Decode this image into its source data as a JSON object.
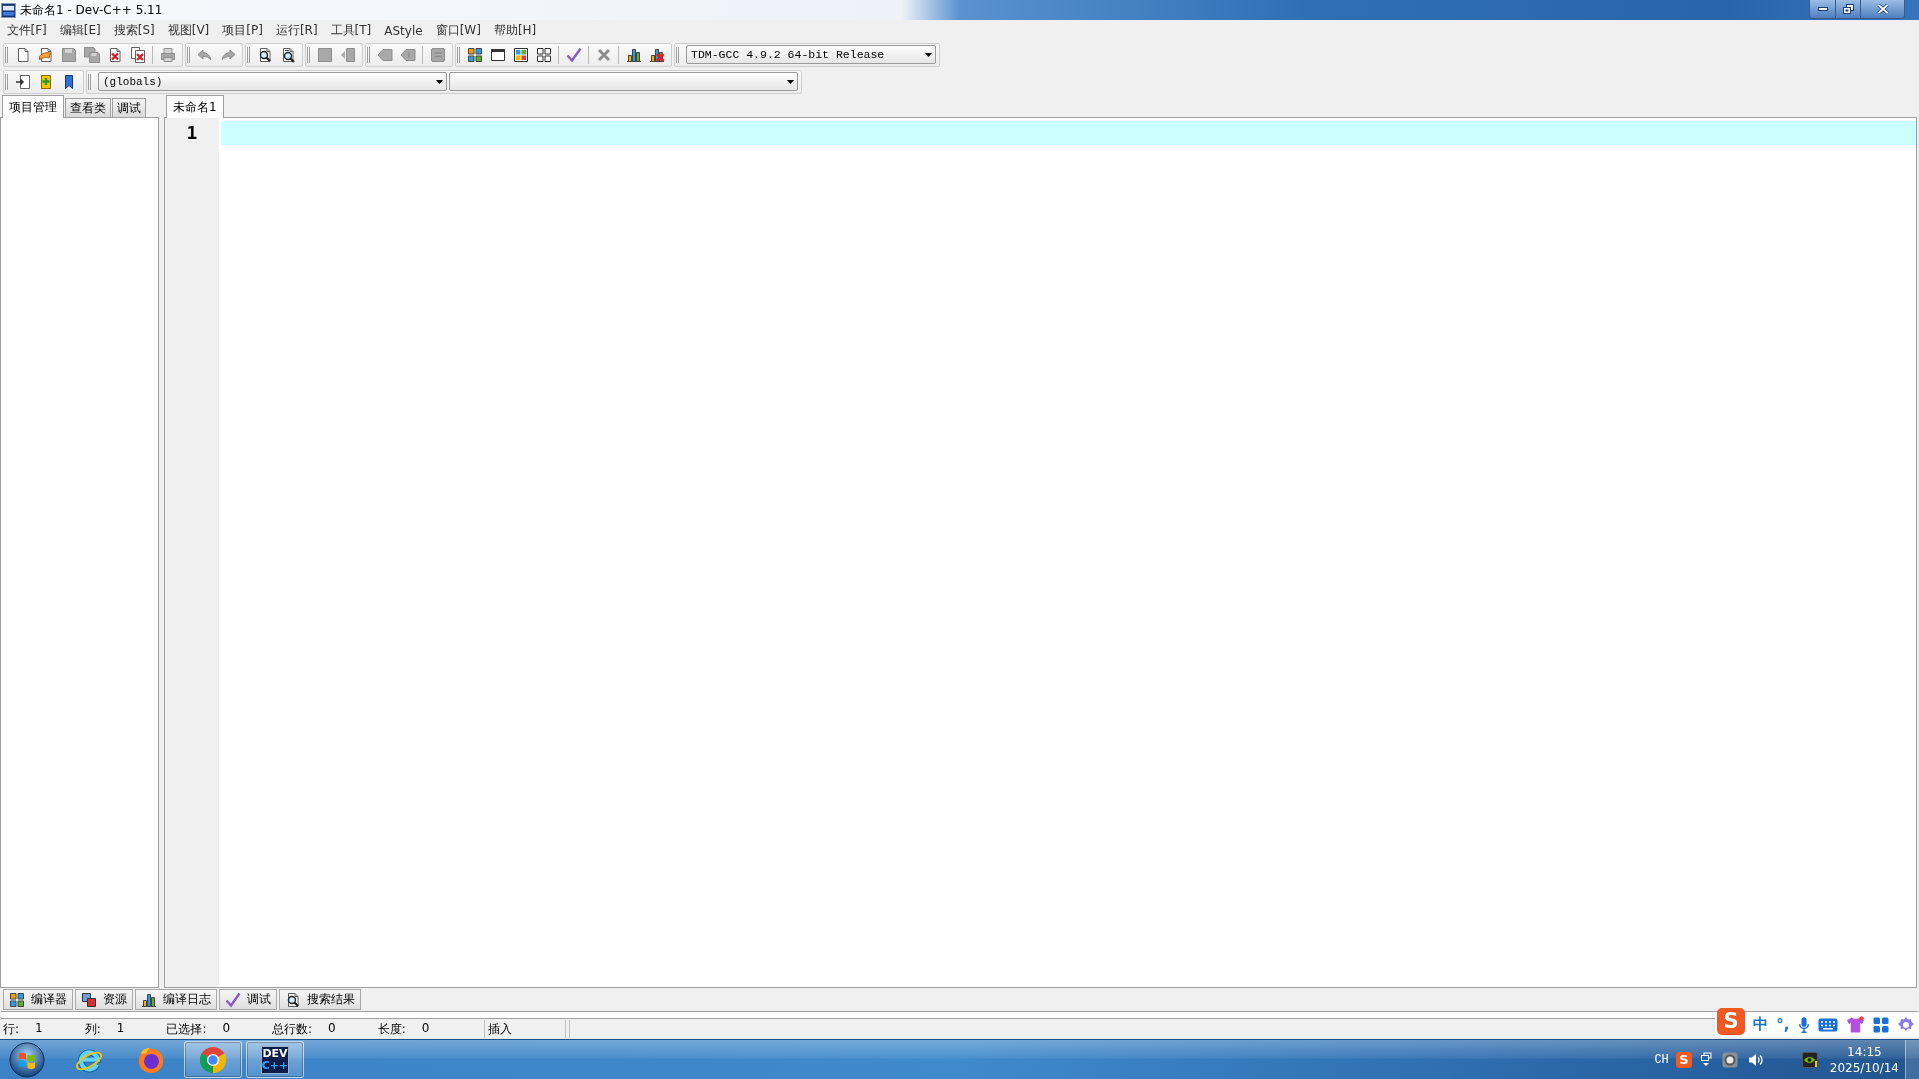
{
  "window": {
    "title": "未命名1 - Dev-C++ 5.11"
  },
  "menu": [
    "文件[F]",
    "编辑[E]",
    "搜索[S]",
    "视图[V]",
    "项目[P]",
    "运行[R]",
    "工具[T]",
    "AStyle",
    "窗口[W]",
    "帮助[H]"
  ],
  "toolbar": {
    "bands": [
      [
        [
          {
            "kind": "new",
            "disabled": false
          },
          {
            "kind": "open",
            "disabled": false
          },
          {
            "kind": "save",
            "disabled": true
          },
          {
            "kind": "save_all",
            "disabled": true
          },
          {
            "kind": "close",
            "disabled": false
          },
          {
            "kind": "close_all",
            "disabled": false
          }
        ],
        [
          {
            "kind": "print",
            "disabled": true
          }
        ]
      ],
      [
        [
          {
            "kind": "undo",
            "disabled": true
          },
          {
            "kind": "redo",
            "disabled": true
          }
        ]
      ],
      [
        [
          {
            "kind": "find",
            "disabled": false
          },
          {
            "kind": "replace",
            "disabled": false
          }
        ]
      ],
      [
        [
          {
            "kind": "add_to_project",
            "disabled": true
          },
          {
            "kind": "remove_from_project",
            "disabled": true
          }
        ]
      ],
      [
        [
          {
            "kind": "indent",
            "disabled": true
          },
          {
            "kind": "unindent",
            "disabled": true
          }
        ],
        [
          {
            "kind": "toggle_comment",
            "disabled": true
          }
        ]
      ],
      [
        [
          {
            "kind": "compile",
            "disabled": false
          },
          {
            "kind": "run",
            "disabled": false
          },
          {
            "kind": "compile_run",
            "disabled": false
          },
          {
            "kind": "rebuild",
            "disabled": false
          }
        ],
        [
          {
            "kind": "syntax_check",
            "disabled": false
          }
        ],
        [
          {
            "kind": "stop",
            "disabled": true
          }
        ],
        [
          {
            "kind": "profile",
            "disabled": false
          },
          {
            "kind": "delete_profile",
            "disabled": false
          }
        ]
      ]
    ],
    "compiler": "TDM-GCC 4.9.2 64-bit Release"
  },
  "class_toolbar": {
    "buttons": [
      {
        "kind": "insert",
        "disabled": false
      },
      {
        "kind": "toggle_bookmark",
        "disabled": false
      },
      {
        "kind": "goto_bookmark",
        "disabled": false
      }
    ],
    "scope": "(globals)"
  },
  "side_panel": {
    "tabs": [
      {
        "label": "项目管理",
        "selected": true
      },
      {
        "label": "查看类",
        "selected": false
      },
      {
        "label": "调试",
        "selected": false
      }
    ]
  },
  "editor": {
    "tabs": [
      {
        "label": "未命名1",
        "selected": true
      }
    ],
    "lines": [
      {
        "number": "1",
        "current": true
      }
    ]
  },
  "bottom_tabs": [
    {
      "kind": "compiler",
      "label": "编译器"
    },
    {
      "kind": "resources",
      "label": "资源"
    },
    {
      "kind": "compile_log",
      "label": "编译日志"
    },
    {
      "kind": "debug",
      "label": "调试"
    },
    {
      "kind": "search_results",
      "label": "搜索结果"
    }
  ],
  "status_bar": {
    "fields": [
      {
        "label": "行:",
        "value": "1"
      },
      {
        "label": "列:",
        "value": "1"
      },
      {
        "label": "已选择:",
        "value": "0"
      },
      {
        "label": "总行数:",
        "value": "0"
      },
      {
        "label": "长度:",
        "value": "0"
      }
    ],
    "mode": "插入"
  },
  "ime_bar": {
    "logo": "S",
    "mode": "中",
    "punctuation": "°,"
  },
  "taskbar": {
    "apps": [
      {
        "kind": "ie",
        "open": false
      },
      {
        "kind": "firefox",
        "open": false
      },
      {
        "kind": "chrome",
        "open": true
      },
      {
        "kind": "devcpp",
        "open": true,
        "logo_text": [
          "DEV",
          "C++"
        ]
      }
    ],
    "tray": {
      "language": "CH",
      "ime_logo": "S",
      "time": "14:15",
      "date": "2025/10/14"
    }
  }
}
